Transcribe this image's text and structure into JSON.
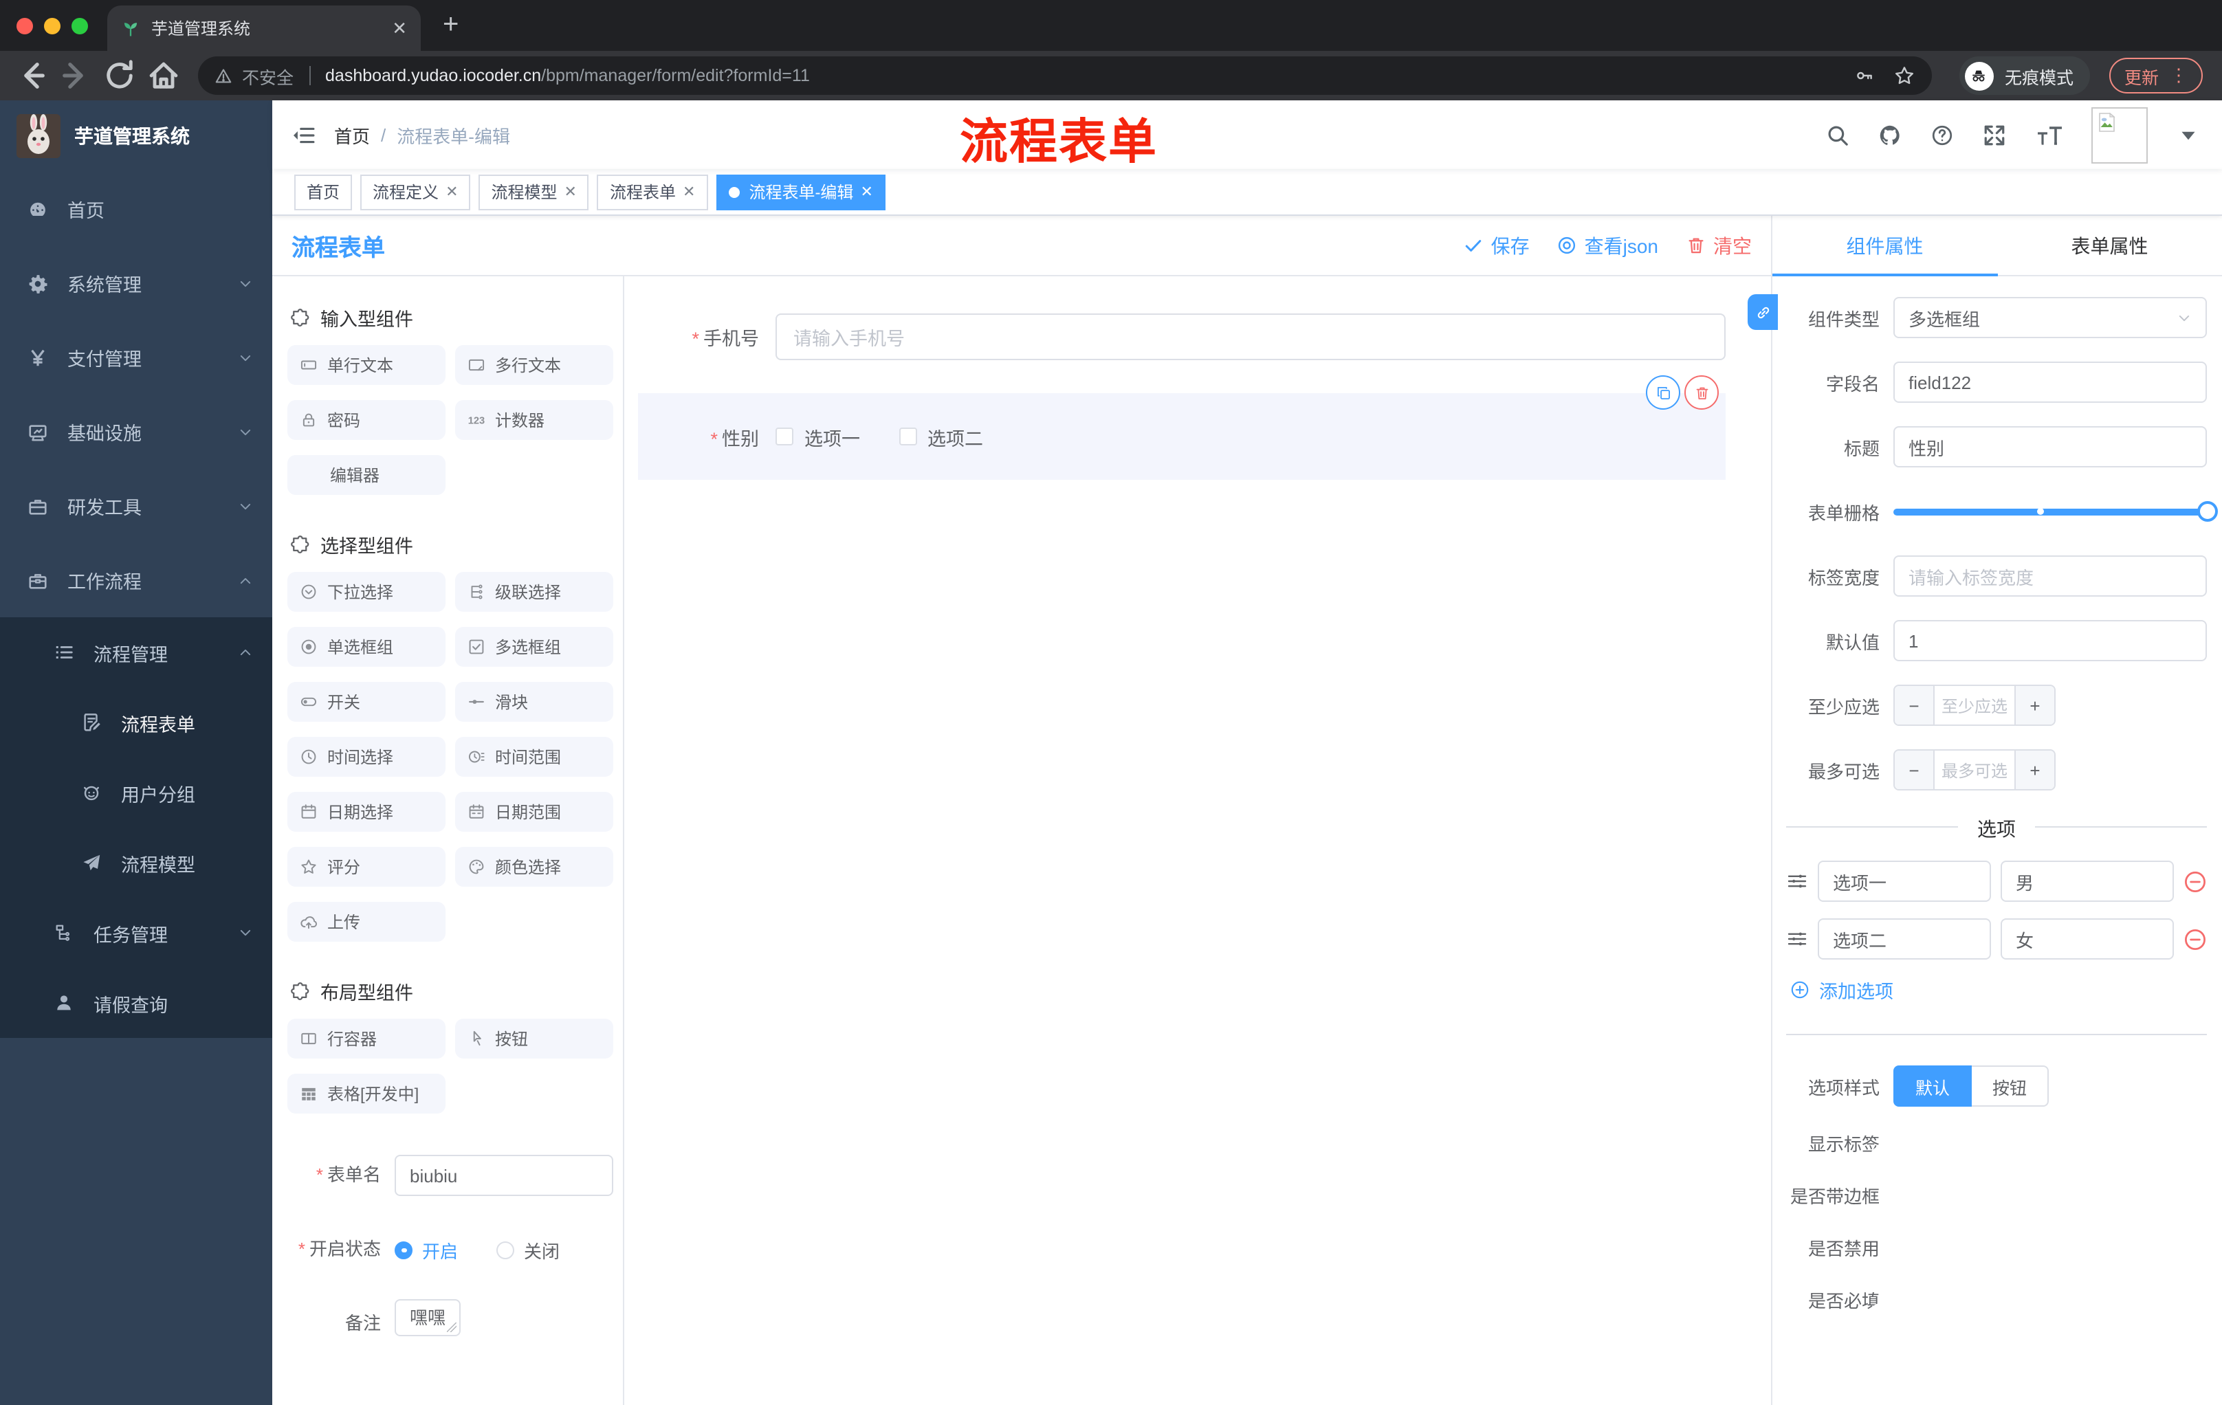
{
  "browser": {
    "tab_title": "芋道管理系统",
    "security_label": "不安全",
    "url_host": "dashboard.yudao.iocoder.cn",
    "url_path": "/bpm/manager/form/edit?formId=11",
    "incognito_label": "无痕模式",
    "update_label": "更新"
  },
  "sidebar": {
    "logo_title": "芋道管理系统",
    "items": [
      {
        "label": "首页",
        "icon": "dashboard-icon",
        "level": 0
      },
      {
        "label": "系统管理",
        "icon": "gear-icon",
        "level": 0,
        "chevron": "down"
      },
      {
        "label": "支付管理",
        "icon": "yen-icon",
        "level": 0,
        "chevron": "down"
      },
      {
        "label": "基础设施",
        "icon": "monitor-icon",
        "level": 0,
        "chevron": "down"
      },
      {
        "label": "研发工具",
        "icon": "briefcase-icon",
        "level": 0,
        "chevron": "down"
      },
      {
        "label": "工作流程",
        "icon": "toolbox-icon",
        "level": 0,
        "chevron": "up"
      },
      {
        "label": "流程管理",
        "icon": "list-tree-icon",
        "level": 1,
        "chevron": "up",
        "sub": true
      },
      {
        "label": "流程表单",
        "icon": "document-edit-icon",
        "level": 2,
        "sub": true,
        "active": true
      },
      {
        "label": "用户分组",
        "icon": "robot-icon",
        "level": 2,
        "sub": true
      },
      {
        "label": "流程模型",
        "icon": "paper-plane-icon",
        "level": 2,
        "sub": true
      },
      {
        "label": "任务管理",
        "icon": "flow-icon",
        "level": 1,
        "chevron": "down",
        "sub": true
      },
      {
        "label": "请假查询",
        "icon": "user-icon",
        "level": 1,
        "sub": true
      }
    ]
  },
  "navbar": {
    "breadcrumb": {
      "home": "首页",
      "separator": "/",
      "current": "流程表单-编辑"
    },
    "annotation": "流程表单"
  },
  "tags_view": [
    {
      "label": "首页",
      "closable": false,
      "active": false
    },
    {
      "label": "流程定义",
      "closable": true,
      "active": false
    },
    {
      "label": "流程模型",
      "closable": true,
      "active": false
    },
    {
      "label": "流程表单",
      "closable": true,
      "active": false
    },
    {
      "label": "流程表单-编辑",
      "closable": true,
      "active": true
    }
  ],
  "designer": {
    "title": "流程表单",
    "save_label": "保存",
    "view_json_label": "查看json",
    "clear_label": "清空"
  },
  "components_panel": {
    "sections": [
      {
        "title": "输入型组件",
        "items": [
          {
            "label": "单行文本",
            "icon": "input-icon"
          },
          {
            "label": "多行文本",
            "icon": "textarea-icon"
          },
          {
            "label": "密码",
            "icon": "lock-icon"
          },
          {
            "label": "计数器",
            "icon": "counter-icon"
          },
          {
            "label": "编辑器",
            "icon": ""
          }
        ]
      },
      {
        "title": "选择型组件",
        "items": [
          {
            "label": "下拉选择",
            "icon": "select-icon"
          },
          {
            "label": "级联选择",
            "icon": "cascade-icon"
          },
          {
            "label": "单选框组",
            "icon": "radio-icon"
          },
          {
            "label": "多选框组",
            "icon": "checkbox-icon"
          },
          {
            "label": "开关",
            "icon": "switch-icon"
          },
          {
            "label": "滑块",
            "icon": "slider-icon"
          },
          {
            "label": "时间选择",
            "icon": "time-icon"
          },
          {
            "label": "时间范围",
            "icon": "time-range-icon"
          },
          {
            "label": "日期选择",
            "icon": "date-icon"
          },
          {
            "label": "日期范围",
            "icon": "date-range-icon"
          },
          {
            "label": "评分",
            "icon": "star-icon"
          },
          {
            "label": "颜色选择",
            "icon": "palette-icon"
          },
          {
            "label": "上传",
            "icon": "upload-icon"
          }
        ]
      },
      {
        "title": "布局型组件",
        "items": [
          {
            "label": "行容器",
            "icon": "row-container-icon"
          },
          {
            "label": "按钮",
            "icon": "pointer-icon"
          },
          {
            "label": "表格[开发中]",
            "icon": "table-icon"
          }
        ]
      }
    ],
    "form": {
      "name_label": "表单名",
      "name_value": "biubiu",
      "status_label": "开启状态",
      "status_on": "开启",
      "status_off": "关闭",
      "remark_label": "备注",
      "remark_value": "嘿嘿"
    }
  },
  "canvas": {
    "phone_field": {
      "label": "手机号",
      "placeholder": "请输入手机号"
    },
    "gender_field": {
      "label": "性别",
      "options": [
        "选项一",
        "选项二"
      ]
    }
  },
  "props": {
    "tabs": {
      "component": "组件属性",
      "form": "表单属性"
    },
    "type_label": "组件类型",
    "type_value": "多选框组",
    "field_label": "字段名",
    "field_value": "field122",
    "title_label": "标题",
    "title_value": "性别",
    "grid_label": "表单栅格",
    "label_width_label": "标签宽度",
    "label_width_placeholder": "请输入标签宽度",
    "default_label": "默认值",
    "default_value": "1",
    "min_label": "至少应选",
    "min_placeholder": "至少应选",
    "max_label": "最多可选",
    "max_placeholder": "最多可选",
    "options_title": "选项",
    "options": [
      {
        "label": "选项一",
        "value": "男"
      },
      {
        "label": "选项二",
        "value": "女"
      }
    ],
    "add_option_label": "添加选项",
    "style_label": "选项样式",
    "style_default": "默认",
    "style_button": "按钮",
    "show_label_label": "显示标签",
    "show_label_on": true,
    "border_label": "是否带边框",
    "border_on": false,
    "disabled_label": "是否禁用",
    "disabled_on": false,
    "required_label": "是否必填",
    "required_on": true
  }
}
